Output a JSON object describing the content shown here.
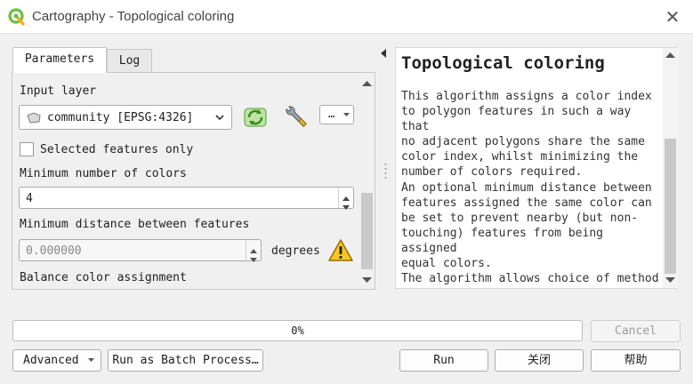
{
  "window": {
    "title": "Cartography - Topological coloring"
  },
  "tabs": [
    {
      "label": "Parameters"
    },
    {
      "label": "Log"
    }
  ],
  "params": {
    "input_layer_label": "Input layer",
    "input_layer_value": "community [EPSG:4326]",
    "layer_options_btn": "…",
    "selected_only_label": "Selected features only",
    "min_colors_label": "Minimum number of colors",
    "min_colors_value": "4",
    "min_distance_label": "Minimum distance between features",
    "min_distance_value": "0.000000",
    "min_distance_unit": "degrees",
    "balance_label": "Balance color assignment"
  },
  "help": {
    "title": "Topological coloring",
    "paragraphs": [
      "This algorithm assigns a color index\nto polygon features in such a way that\nno adjacent polygons share the same\ncolor index, whilst minimizing the\nnumber of colors required.",
      "An optional minimum distance between\nfeatures assigned the same color can\nbe set to prevent nearby (but non-\ntouching) features from being assigned\nequal colors.",
      "The algorithm allows choice of method"
    ]
  },
  "progress": {
    "text": "0%",
    "value": 0
  },
  "buttons": {
    "cancel": "Cancel",
    "advanced": "Advanced",
    "batch": "Run as Batch Process…",
    "run": "Run",
    "close": "关闭",
    "help": "帮助"
  },
  "colors": {
    "accent_green": "#6cbf3f",
    "warning_yellow": "#f7c623"
  },
  "icons": [
    "qgis-logo-icon",
    "close-icon",
    "polygon-layer-icon",
    "iterate-icon",
    "wrench-icon",
    "warning-icon"
  ]
}
